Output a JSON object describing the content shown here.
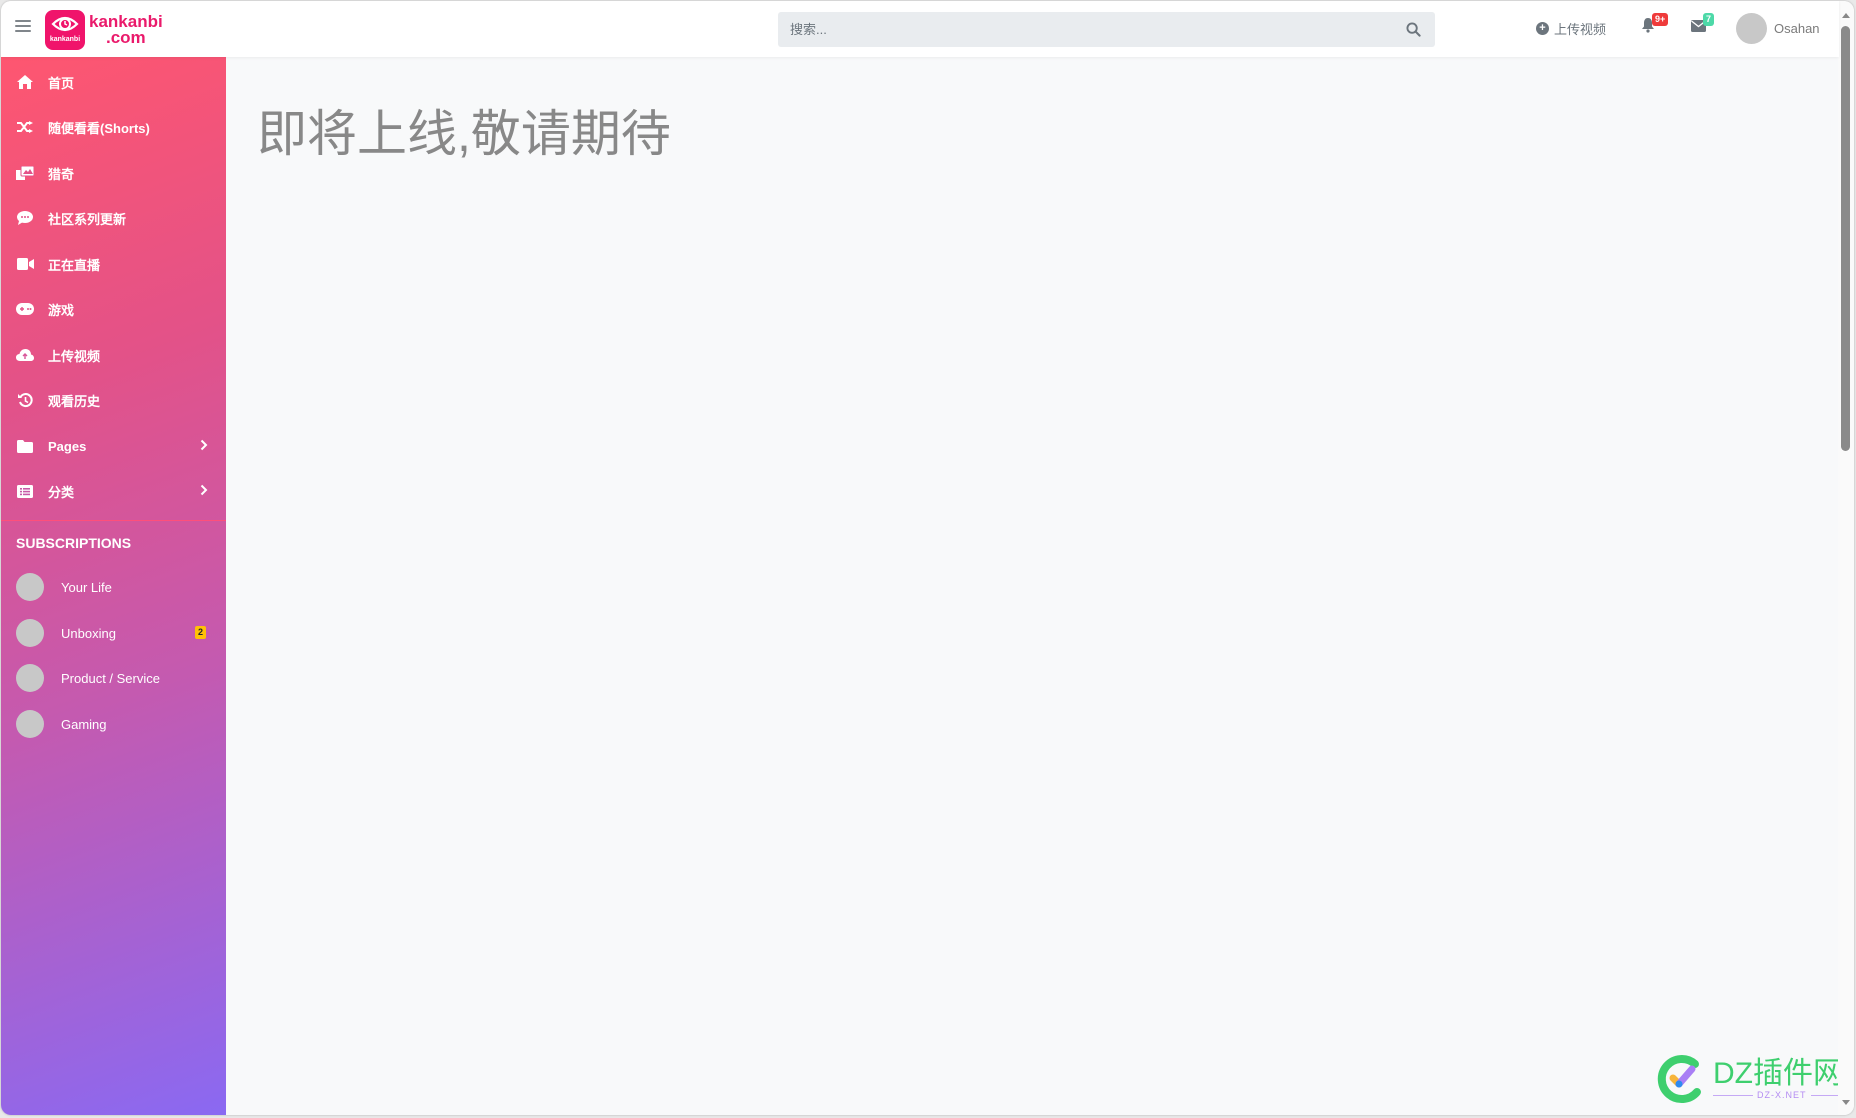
{
  "header": {
    "logo_text_line1": "kankanbi",
    "logo_text_line2": ".com",
    "logo_icon_caption": "kankanbi",
    "search": {
      "placeholder": "搜索...",
      "value": ""
    },
    "upload_label": "上传视频",
    "notifications_badge": "9+",
    "messages_badge": "7",
    "user_name": "Osahan"
  },
  "sidebar": {
    "items": [
      {
        "label": "首页",
        "icon": "home-icon"
      },
      {
        "label": "随便看看(Shorts)",
        "icon": "shuffle-icon"
      },
      {
        "label": "猎奇",
        "icon": "images-icon"
      },
      {
        "label": "社区系列更新",
        "icon": "sms-comment-icon"
      },
      {
        "label": "正在直播",
        "icon": "video-camera-icon"
      },
      {
        "label": "游戏",
        "icon": "gamepad-icon"
      },
      {
        "label": "上传视频",
        "icon": "cloud-upload-icon"
      },
      {
        "label": "观看历史",
        "icon": "history-icon"
      },
      {
        "label": "Pages",
        "icon": "folder-icon",
        "has_submenu": true
      },
      {
        "label": "分类",
        "icon": "list-icon",
        "has_submenu": true
      }
    ],
    "subscriptions_heading": "SUBSCRIPTIONS",
    "subscriptions": [
      {
        "label": "Your Life",
        "badge": null
      },
      {
        "label": "Unboxing",
        "badge": "2"
      },
      {
        "label": "Product / Service",
        "badge": null
      },
      {
        "label": "Gaming",
        "badge": null
      }
    ]
  },
  "main": {
    "title": "即将上线,敬请期待"
  },
  "watermark": {
    "text": "DZ插件网",
    "subtext": "DZ-X.NET"
  },
  "colors": {
    "brand": "#ea1a6b",
    "sidebar_gradient_start": "#fe5670",
    "sidebar_gradient_end": "#8a69f2",
    "notification_badge": "#ef3b3b",
    "message_badge": "#4dd9a8",
    "subscription_badge": "#ffc107"
  }
}
